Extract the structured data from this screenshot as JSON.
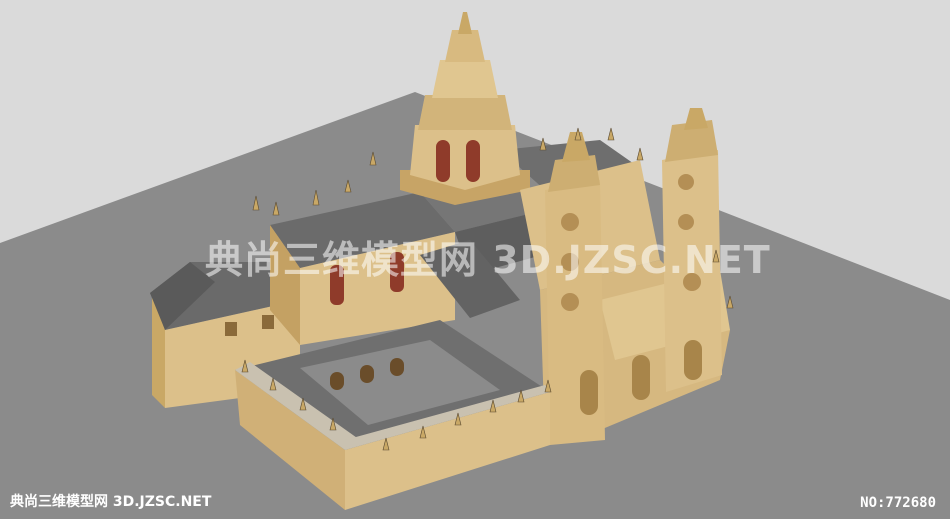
{
  "watermark": {
    "text": "典尚三维模型网 3D.JZSC.NET"
  },
  "footer": {
    "site_label": "典尚三维模型网 3D.JZSC.NET",
    "model_number": "NO:772680"
  },
  "colors": {
    "sky": "#d9d9d9",
    "ground": "#8a8a8a",
    "stone_light": "#e0c690",
    "stone_mid": "#cfae6e",
    "stone_dark": "#a8854a",
    "roof": "#5e5e5e",
    "roof_light": "#767676",
    "window": "#8f3b2a"
  }
}
